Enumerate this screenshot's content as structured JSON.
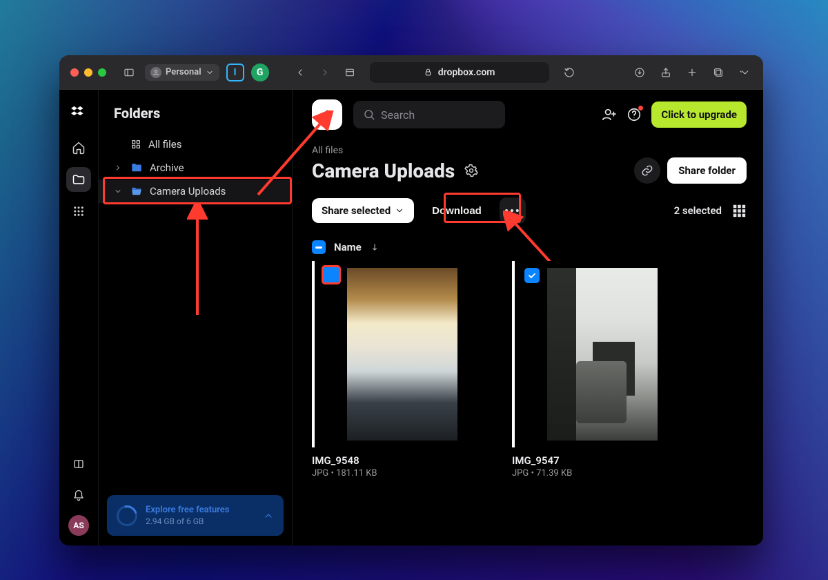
{
  "browser": {
    "profile_label": "Personal",
    "address": "dropbox.com"
  },
  "rail": {
    "avatar_initials": "AS"
  },
  "sidebar": {
    "title": "Folders",
    "items": [
      {
        "label": "All files",
        "data_name": "tree-item-all-files"
      },
      {
        "label": "Archive",
        "data_name": "tree-item-archive"
      },
      {
        "label": "Camera Uploads",
        "data_name": "tree-item-camera-uploads"
      }
    ],
    "promo": {
      "title": "Explore free features",
      "subtitle": "2.94 GB of 6 GB"
    }
  },
  "topbar": {
    "search_placeholder": "Search",
    "upgrade_label": "Click to upgrade"
  },
  "header": {
    "breadcrumb": "All files",
    "title": "Camera Uploads",
    "share_folder_label": "Share folder"
  },
  "actions": {
    "share_selected_label": "Share selected",
    "download_label": "Download",
    "selected_count_label": "2 selected"
  },
  "list": {
    "sort_label": "Name"
  },
  "files": [
    {
      "name": "IMG_9548",
      "meta": "JPG • 181.11 KB",
      "thumb_kind": "arch"
    },
    {
      "name": "IMG_9547",
      "meta": "JPG • 71.39 KB",
      "thumb_kind": "room"
    }
  ]
}
